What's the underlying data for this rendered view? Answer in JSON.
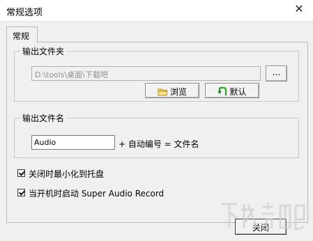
{
  "window": {
    "title": "常规选项"
  },
  "tabs": [
    {
      "label": "常规"
    }
  ],
  "output_folder": {
    "label": "输出文件夹",
    "path": "D:\\tools\\桌面\\下载吧",
    "browse_dots": "...",
    "browse_label": "浏览",
    "default_label": "默认"
  },
  "output_filename": {
    "label": "输出文件名",
    "value": "Audio",
    "suffix_text": "+ 自动编号 = 文件名"
  },
  "options": [
    {
      "label": "关闭时最小化到托盘",
      "checked": true
    },
    {
      "label": "当开机时启动 Super Audio Record",
      "checked": true
    }
  ],
  "footer": {
    "close_label": "关闭"
  }
}
